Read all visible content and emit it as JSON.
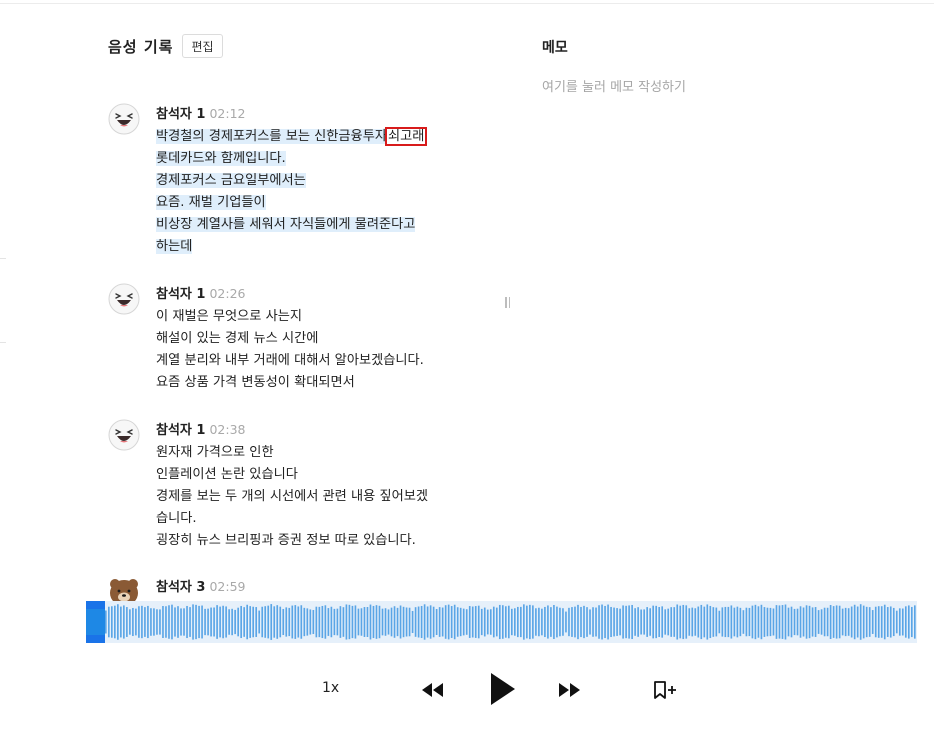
{
  "header": {
    "title": "음성 기록",
    "edit_label": "편집"
  },
  "memo": {
    "title": "메모",
    "placeholder": "여기를 눌러 메모 작성하기"
  },
  "entries": [
    {
      "speaker": "참석자 1",
      "time": "02:12",
      "avatar": "cony-face-icon",
      "lines": [
        {
          "before": "박경철의 경제포커스를 보는 신한금융투자",
          "focus": "쇠고래"
        },
        {
          "text": "롯데카드와 함께입니다."
        },
        {
          "text": "경제포커스 금요일부에서는"
        },
        {
          "text": "요즘. 재벌 기업들이"
        },
        {
          "text": "비상장 계열사를 세워서 자식들에게 물려준다고"
        },
        {
          "text": "하는데"
        }
      ]
    },
    {
      "speaker": "참석자 1",
      "time": "02:26",
      "avatar": "cony-face-icon",
      "lines": [
        {
          "text": "이 재벌은 무엇으로 사는지"
        },
        {
          "text": "해설이 있는 경제 뉴스 시간에"
        },
        {
          "text": "계열 분리와 내부 거래에 대해서 알아보겠습니다."
        },
        {
          "text": "요즘 상품 가격 변동성이 확대되면서"
        }
      ]
    },
    {
      "speaker": "참석자 1",
      "time": "02:38",
      "avatar": "cony-face-icon",
      "lines": [
        {
          "text": "원자재 가격으로 인한"
        },
        {
          "text": "인플레이션 논란 있습니다"
        },
        {
          "text": "경제를 보는 두 개의 시선에서 관련 내용 짚어보겠"
        },
        {
          "text": "습니다."
        },
        {
          "text": "굉장히 뉴스 브리핑과 증권 정보 따로 있습니다."
        }
      ]
    },
    {
      "speaker": "참석자 3",
      "time": "02:59",
      "avatar": "brown-bear-icon",
      "lines": []
    }
  ],
  "player": {
    "speed_label": "1x",
    "rewind_icon": "rewind-icon",
    "play_icon": "play-icon",
    "forward_icon": "fast-forward-icon",
    "bookmark_icon": "bookmark-add-icon",
    "progress": 0.0,
    "colors": {
      "accent": "#1e88e5",
      "wave_bar": "#5aa5e6",
      "wave_bg": "#e6f0fa",
      "highlight": "#dfeefb",
      "focus_box": "#d81b1b"
    }
  }
}
